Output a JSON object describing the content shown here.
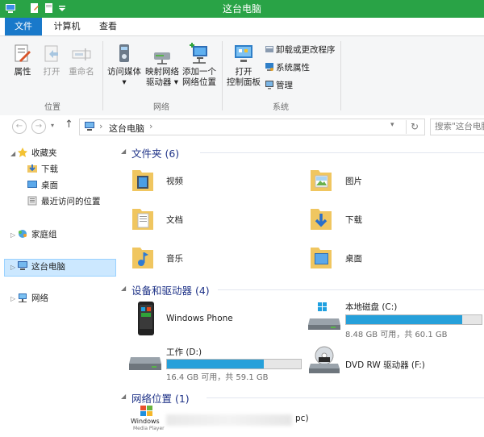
{
  "window": {
    "title": "这台电脑"
  },
  "quick_access_icons": [
    "computer-icon",
    "properties-icon",
    "new-folder-icon",
    "customize-qat-icon"
  ],
  "ribbon": {
    "tabs": [
      {
        "label": "文件",
        "active": true
      },
      {
        "label": "计算机",
        "active": false
      },
      {
        "label": "查看",
        "active": false
      }
    ],
    "location_group": {
      "label": "位置",
      "buttons": [
        {
          "label": "属性",
          "enabled": true,
          "icon": "properties-icon"
        },
        {
          "label": "打开",
          "enabled": false,
          "icon": "open-icon"
        },
        {
          "label": "重命名",
          "enabled": false,
          "icon": "rename-icon"
        }
      ]
    },
    "network_group": {
      "label": "网络",
      "buttons": [
        {
          "line1": "访问媒体",
          "line2": "▾",
          "icon": "media-access-icon"
        },
        {
          "line1": "映射网络",
          "line2": "驱动器 ▾",
          "icon": "map-drive-icon"
        },
        {
          "line1": "添加一个",
          "line2": "网络位置",
          "icon": "add-network-location-icon"
        }
      ]
    },
    "system_group": {
      "label": "系统",
      "open_cp": {
        "line1": "打开",
        "line2": "控制面板",
        "icon": "control-panel-icon"
      },
      "small_buttons": [
        {
          "label": "卸载或更改程序",
          "icon": "uninstall-icon"
        },
        {
          "label": "系统属性",
          "icon": "system-properties-icon"
        },
        {
          "label": "管理",
          "icon": "manage-icon"
        }
      ]
    }
  },
  "address": {
    "path": "这台电脑",
    "separator": "›",
    "search_placeholder": "搜索\"这台电脑\""
  },
  "nav_pane": {
    "favorites": {
      "label": "收藏夹",
      "children": [
        "下载",
        "桌面",
        "最近访问的位置"
      ]
    },
    "homegroup": {
      "label": "家庭组"
    },
    "this_pc": {
      "label": "这台电脑",
      "selected": true
    },
    "network": {
      "label": "网络"
    }
  },
  "folders_section": {
    "title": "文件夹 (6)",
    "items": [
      {
        "name": "视频",
        "icon": "videos-folder-icon"
      },
      {
        "name": "图片",
        "icon": "pictures-folder-icon"
      },
      {
        "name": "文档",
        "icon": "documents-folder-icon"
      },
      {
        "name": "下载",
        "icon": "downloads-folder-icon"
      },
      {
        "name": "音乐",
        "icon": "music-folder-icon"
      },
      {
        "name": "桌面",
        "icon": "desktop-folder-icon"
      }
    ]
  },
  "devices_section": {
    "title": "设备和驱动器 (4)",
    "items": [
      {
        "name": "Windows Phone",
        "icon": "phone-icon"
      },
      {
        "name": "本地磁盘 (C:)",
        "icon": "system-drive-icon",
        "free_text": "8.48 GB 可用，共 60.1 GB",
        "used_fraction": 0.86
      },
      {
        "name": "工作 (D:)",
        "icon": "hard-drive-icon",
        "free_text": "16.4 GB 可用，共 59.1 GB",
        "used_fraction": 0.72
      },
      {
        "name": "DVD RW 驱动器 (F:)",
        "icon": "dvd-drive-icon"
      }
    ]
  },
  "network_section": {
    "title": "网络位置 (1)",
    "items": [
      {
        "name_suffix": "pc)",
        "icon": "windows-media-player-icon",
        "icon_caption_line1": "Windows",
        "icon_caption_line2": "Media Player"
      }
    ]
  },
  "colors": {
    "titlebar": "#29a346",
    "file_tab": "#1979ca",
    "section_title": "#1e3287",
    "drive_bar": "#26a0da",
    "selection": "#cce8ff"
  }
}
